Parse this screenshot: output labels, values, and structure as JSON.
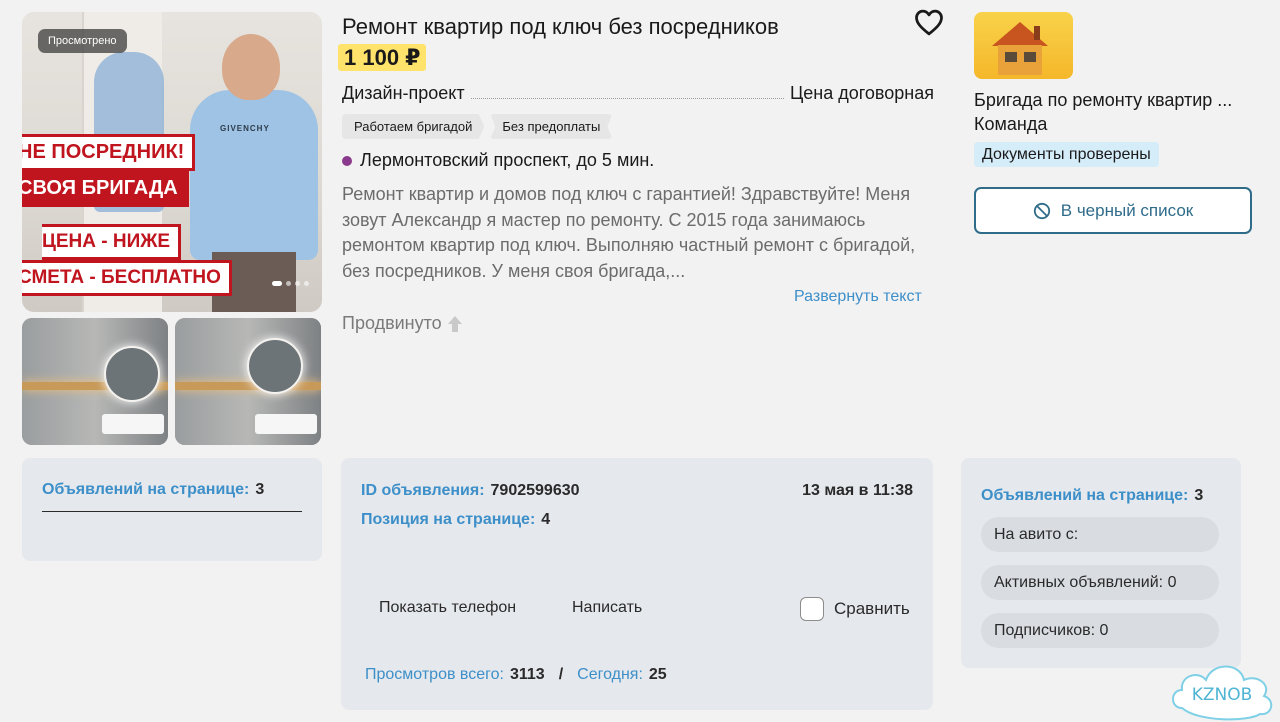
{
  "gallery": {
    "viewed_badge": "Просмотрено",
    "banners": [
      "НЕ ПОСРЕДНИК!",
      "СВОЯ БРИГАДА",
      "ЦЕНА - НИЖЕ",
      "СМЕТА - БЕСПЛАТНО"
    ],
    "shirt_logo": "GIVENCHY"
  },
  "listing": {
    "title": "Ремонт квартир под ключ без посредников",
    "price": "1 100 ₽",
    "param_label": "Дизайн-проект",
    "param_value": "Цена договорная",
    "tags": [
      "Работаем бригадой",
      "Без предоплаты"
    ],
    "metro": "Лермонтовский проспект, до 5 мин.",
    "description": "Ремонт квартир и домов под ключ с гарантией! Здравствуйте! Меня зовут Александр я мастер по ремонту. С 2015 года занимаюсь ремонтом квартир под ключ. Выполняю частный ремонт с бригадой, без посредников. У меня своя бригада,...",
    "expand_link": "Развернуть текст",
    "promoted": "Продвинуто",
    "colors": {
      "price_bg": "#ffe36b",
      "metro": "#8a3a8c",
      "link": "#3d8fc9"
    }
  },
  "seller": {
    "name_line1": "Бригада по ремонту квартир ...",
    "name_line2": "Команда",
    "verified": "Документы проверены",
    "blacklist_button": "В черный список"
  },
  "stats_left": {
    "label": "Объявлений на странице:",
    "value": "3"
  },
  "stats_mid": {
    "id_label": "ID объявления:",
    "id_value": "7902599630",
    "date": "13 мая в 11:38",
    "position_label": "Позиция на странице:",
    "position_value": "4",
    "show_phone": "Показать телефон",
    "write": "Написать",
    "compare": "Сравнить",
    "views_total_label": "Просмотров всего:",
    "views_total_value": "3113",
    "views_sep": "/",
    "views_today_label": "Сегодня:",
    "views_today_value": "25"
  },
  "stats_right": {
    "label": "Объявлений на странице:",
    "value": "3",
    "on_avito": "На авито с:",
    "active_ads": "Активных объявлений: 0",
    "subscribers": "Подписчиков: 0"
  },
  "watermark": "KZNOB"
}
